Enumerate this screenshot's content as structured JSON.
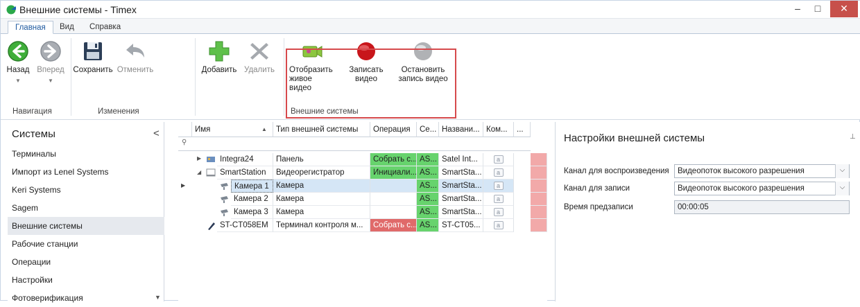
{
  "window": {
    "title": "Внешние системы - Timex",
    "minimize": "–",
    "maximize": "□",
    "close": "✕"
  },
  "tabs": [
    {
      "label": "Главная"
    },
    {
      "label": "Вид"
    },
    {
      "label": "Справка"
    }
  ],
  "ribbon": {
    "back": "Назад",
    "forward": "Вперед",
    "save": "Сохранить",
    "undo": "Отменить",
    "add": "Добавить",
    "delete": "Удалить",
    "show_video_1": "Отобразить",
    "show_video_2": "живое видео",
    "record_1": "Записать",
    "record_2": "видео",
    "stop_1": "Остановить",
    "stop_2": "запись видео",
    "group_nav": "Навигация",
    "group_changes": "Изменения",
    "group_ext": "Внешние системы"
  },
  "sidebar": {
    "title": "Системы",
    "collapse": "<",
    "items": [
      {
        "label": "Терминалы"
      },
      {
        "label": "Импорт из Lenel Systems"
      },
      {
        "label": "Keri Systems"
      },
      {
        "label": "Sagem"
      },
      {
        "label": "Внешние системы"
      },
      {
        "label": "Рабочие станции"
      },
      {
        "label": "Операции"
      },
      {
        "label": "Настройки"
      },
      {
        "label": "Фотоверификация"
      }
    ]
  },
  "grid": {
    "headers": [
      "Имя",
      "Тип внешней системы",
      "Операция",
      "Се...",
      "Названи...",
      "Ком...",
      "..."
    ],
    "rows": [
      {
        "name": "Integra24",
        "type": "Панель",
        "op": "Собрать с...",
        "se": "AS...",
        "title": "Satel Int..."
      },
      {
        "name": "SmartStation",
        "type": "Видеорегистратор",
        "op": "Инициали...",
        "se": "AS...",
        "title": "SmartSta..."
      },
      {
        "name": "Камера 1",
        "type": "Камера",
        "op": "",
        "se": "AS...",
        "title": "SmartSta..."
      },
      {
        "name": "Камера 2",
        "type": "Камера",
        "op": "",
        "se": "AS...",
        "title": "SmartSta..."
      },
      {
        "name": "Камера 3",
        "type": "Камера",
        "op": "",
        "se": "AS...",
        "title": "SmartSta..."
      },
      {
        "name": "ST-CT058EM",
        "type": "Терминал контроля м...",
        "op": "Собрать с...",
        "se": "AS...",
        "title": "ST-CT05..."
      }
    ],
    "comment_glyph": "a"
  },
  "panel": {
    "title": "Настройки внешней системы",
    "playback_label": "Канал для воспроизведения",
    "playback_value": "Видеопоток высокого разрешения",
    "record_label": "Канал для записи",
    "record_value": "Видеопоток высокого разрешения",
    "prerecord_label": "Время предзаписи",
    "prerecord_value": "00:00:05"
  },
  "colors": {
    "accent": "#1f5aa0",
    "highlight_box": "#d6494c",
    "green_op": "#67d36d",
    "red_op": "#e06a6a",
    "close_button": "#c7504b"
  }
}
